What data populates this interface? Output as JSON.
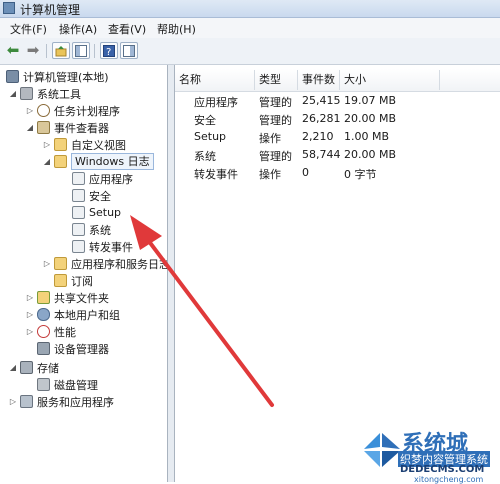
{
  "window": {
    "title": "计算机管理"
  },
  "menu": [
    "文件(F)",
    "操作(A)",
    "查看(V)",
    "帮助(H)"
  ],
  "tree": {
    "root": "计算机管理(本地)",
    "system_tools": "系统工具",
    "task_scheduler": "任务计划程序",
    "event_viewer": "事件查看器",
    "custom_views": "自定义视图",
    "windows_logs": "Windows 日志",
    "logs": [
      "应用程序",
      "安全",
      "Setup",
      "系统",
      "转发事件"
    ],
    "apps_services_logs": "应用程序和服务日志",
    "subscriptions": "订阅",
    "shared_folders": "共享文件夹",
    "local_users": "本地用户和组",
    "performance": "性能",
    "device_manager": "设备管理器",
    "storage": "存储",
    "disk_management": "磁盘管理",
    "services_apps": "服务和应用程序"
  },
  "list": {
    "columns": [
      "名称",
      "类型",
      "事件数",
      "大小"
    ],
    "rows": [
      [
        "应用程序",
        "管理的",
        "25,415",
        "19.07 MB"
      ],
      [
        "安全",
        "管理的",
        "26,281",
        "20.00 MB"
      ],
      [
        "Setup",
        "操作",
        "2,210",
        "1.00 MB"
      ],
      [
        "系统",
        "管理的",
        "58,744",
        "20.00 MB"
      ],
      [
        "转发事件",
        "操作",
        "0",
        "0 字节"
      ]
    ]
  },
  "watermark": {
    "line1": "系统城",
    "line2": "织梦内容管理系统",
    "line3": "DEDECMS.COM",
    "line4": "xitongcheng.com"
  },
  "colors": {
    "annotation_arrow": "#e0393a",
    "accent": "#2f6fb8"
  }
}
